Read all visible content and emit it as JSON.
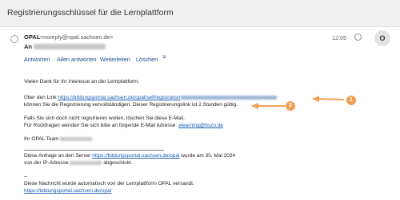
{
  "window": {
    "title": "Registrierungsschlüssel für die Lernplattform"
  },
  "message": {
    "sender_name": "OPAL",
    "sender_address": "<noreply@opal.sachsen.de>",
    "to_label": "An",
    "time": "12:09",
    "avatar_letter": "O"
  },
  "actions": {
    "reply": "Antworten",
    "reply_all": "Allen antworten",
    "forward": "Weiterleiten",
    "delete": "Löschen",
    "more_icon": "hamburger-menu"
  },
  "body": {
    "greeting": "Vielen Dank für Ihr Interesse an der Lernplattform.",
    "link_intro": "Über den Link ",
    "registration_link": "https://bildungsportal.sachsen.de/opal/selfregistration",
    "link_outro": "können Sie die Registrierung vervollständigen. Dieser Registrierungslink ist 2 Stunden gültig.",
    "ignore_line": "Falls Sie sich doch nicht registrieren wollen, löschen Sie diese E-Mail.",
    "questions_prefix": "Für Rückfragen wenden Sie sich bitte an folgende E-Mail Adresse: ",
    "support_email": "elearning@bszo.de",
    "team_prefix": "Ihr OPAL Team",
    "request_prefix": "Diese Anfrage an den Server ",
    "server_link": "https://bildungsportal.sachsen.de/opal",
    "request_suffix": " wurde am 30. Mai 2024",
    "ip_prefix": "von der IP-Adresse ",
    "ip_suffix": " abgeschickt.",
    "signature_dash": "--",
    "auto_note": "Diese Nachricht wurde automatisch von der Lernplattform OPAL versandt.",
    "footer_link": "https://bildungsportal.sachsen.de/opal"
  },
  "annotations": {
    "badge1": "1",
    "badge2": "2",
    "color": "#f29f56"
  }
}
